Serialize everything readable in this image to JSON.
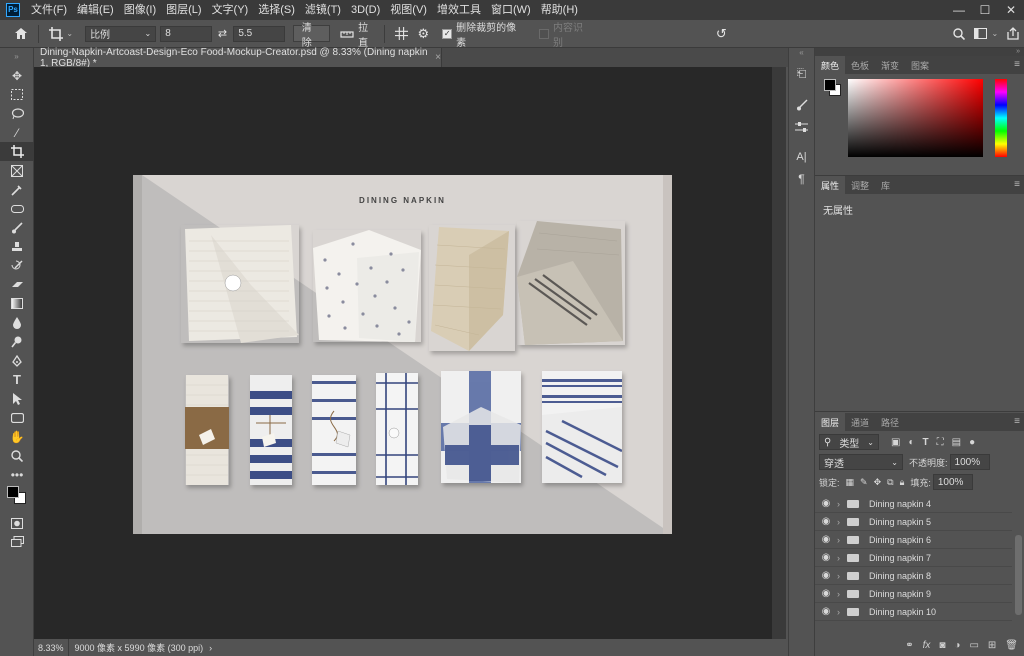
{
  "menubar": {
    "logo": "Ps",
    "items": [
      "文件(F)",
      "编辑(E)",
      "图像(I)",
      "图层(L)",
      "文字(Y)",
      "选择(S)",
      "滤镜(T)",
      "3D(D)",
      "视图(V)",
      "增效工具",
      "窗口(W)",
      "帮助(H)"
    ],
    "window_controls": [
      "—",
      "☐",
      "✕"
    ]
  },
  "options": {
    "ratio_select": "比例",
    "width_value": "8",
    "height_value": "5.5",
    "clear_label": "清除",
    "straighten_label": "拉直",
    "delete_cropped_label": "删除裁剪的像素",
    "content_aware_label": "内容识别"
  },
  "document": {
    "tab_title": "Dining-Napkin-Artcoast-Design-Eco Food-Mockup-Creator.psd @ 8.33% (Dining napkin 1, RGB/8#) *",
    "tab_close": "×",
    "image_title": "DINING NAPKIN",
    "zoom": "8.33%",
    "doc_info": "9000 像素 x 5990 像素 (300 ppi)",
    "status_arrow": "›"
  },
  "panels": {
    "color_tabs": [
      "颜色",
      "色板",
      "渐变",
      "图案"
    ],
    "props_tabs": [
      "属性",
      "调整",
      "库"
    ],
    "props_empty": "无属性",
    "layers_tabs": [
      "图层",
      "通道",
      "路径"
    ],
    "filter_label": "类型",
    "blend_mode": "穿透",
    "opacity_label": "不透明度:",
    "opacity_value": "100%",
    "lock_label": "锁定:",
    "fill_label": "填充:",
    "fill_value": "100%",
    "menu_icon": "≡"
  },
  "layers": [
    "Dining napkin 4",
    "Dining napkin 5",
    "Dining napkin 6",
    "Dining napkin 7",
    "Dining napkin 8",
    "Dining napkin 9",
    "Dining napkin 10"
  ],
  "colors": {
    "foreground": "#000000",
    "background": "#ffffff",
    "accent": "#31a8ff"
  }
}
